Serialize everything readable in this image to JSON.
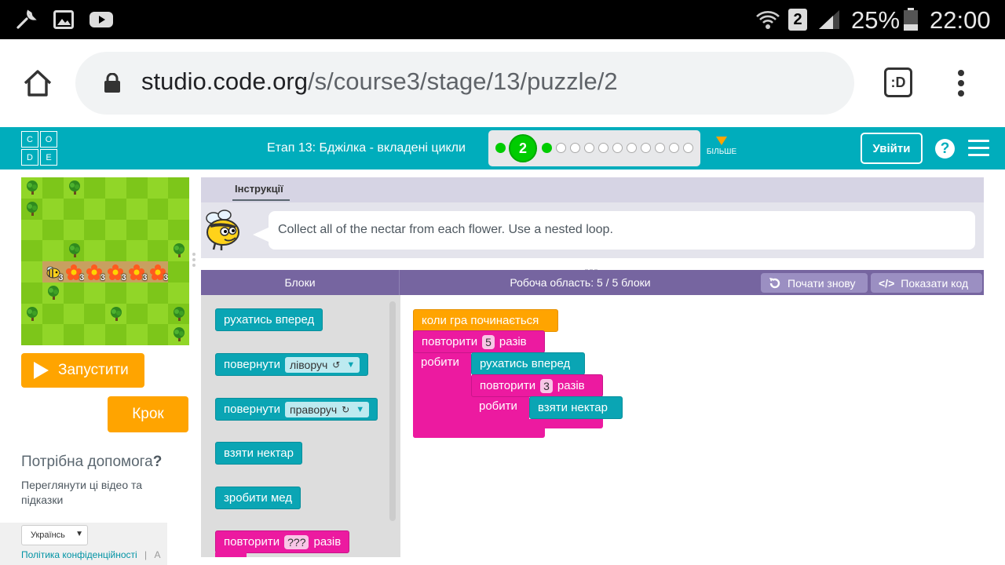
{
  "status_bar": {
    "sim_slot": "2",
    "battery": "25%",
    "time": "22:00"
  },
  "browser": {
    "url_host": "studio.code.org",
    "url_path": "/s/course3/stage/13/puzzle/2"
  },
  "header": {
    "stage_title": "Етап 13: Бджілка - вкладені цикли",
    "current_level": "2",
    "more_label": "БІЛЬШЕ",
    "signin_label": "Увійти",
    "help_label": "?"
  },
  "maze": {
    "flower_count": "3"
  },
  "controls": {
    "run_label": "Запустити",
    "step_label": "Крок"
  },
  "help": {
    "title": "Потрібна допомога",
    "title_mark": "?",
    "text": "Переглянути ці відео та підказки"
  },
  "footer": {
    "language": "Українсь",
    "privacy": "Політика конфіденційності",
    "separator": "|",
    "trailing": "А"
  },
  "instructions": {
    "tab_label": "Інструкції",
    "text": "Collect all of the nectar from each flower. Use a nested loop."
  },
  "workspace_header": {
    "toolbox_label": "Блоки",
    "workspace_label": "Робоча область: 5 / 5 блоки",
    "restart_label": "Почати знову",
    "show_code_label": "Показати код"
  },
  "toolbox": {
    "move_forward": "рухатись вперед",
    "turn_label": "повернути",
    "turn_left_value": "ліворуч",
    "turn_right_value": "праворуч",
    "get_nectar": "взяти нектар",
    "make_honey": "зробити мед",
    "repeat_label": "повторити",
    "repeat_placeholder": "???",
    "repeat_suffix": "разів"
  },
  "program": {
    "when_run": "коли гра починається",
    "outer_repeat_label": "повторити",
    "outer_repeat_count": "5",
    "outer_repeat_suffix": "разів",
    "do_label": "робити",
    "move_forward": "рухатись вперед",
    "inner_repeat_label": "повторити",
    "inner_repeat_count": "3",
    "inner_repeat_suffix": "разів",
    "inner_do_label": "робити",
    "get_nectar": "взяти нектар"
  },
  "colors": {
    "header_teal": "#00adbc",
    "block_teal": "#0aa5b4",
    "block_pink": "#ec1aa0",
    "block_orange": "#ffa400",
    "workspace_purple": "#7665a0"
  }
}
